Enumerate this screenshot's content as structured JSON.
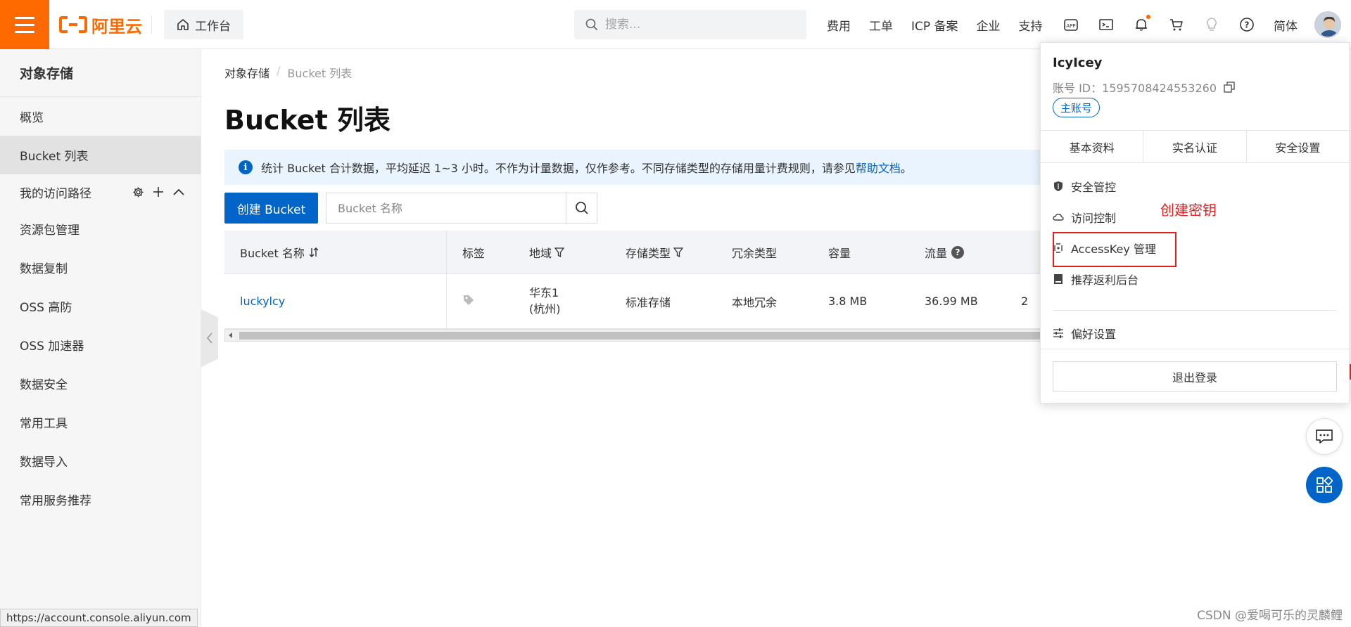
{
  "topbar": {
    "logo_text": "阿里云",
    "workbench_label": "工作台",
    "search_placeholder": "搜索...",
    "links": [
      "费用",
      "工单",
      "ICP 备案",
      "企业",
      "支持"
    ],
    "language": "简体",
    "brand_color": "#ff6a00"
  },
  "sidebar": {
    "title": "对象存储",
    "items": [
      {
        "label": "概览"
      },
      {
        "label": "Bucket 列表"
      },
      {
        "label": "我的访问路径"
      },
      {
        "label": "资源包管理"
      },
      {
        "label": "数据复制"
      },
      {
        "label": "OSS 高防"
      },
      {
        "label": "OSS 加速器"
      },
      {
        "label": "数据安全"
      },
      {
        "label": "常用工具"
      },
      {
        "label": "数据导入"
      },
      {
        "label": "常用服务推荐"
      }
    ]
  },
  "main": {
    "breadcrumb": [
      "对象存储",
      "Bucket 列表"
    ],
    "title": "Bucket 列表",
    "notice_text": "统计 Bucket 合计数据，平均延迟 1~3 小时。不作为计量数据，仅作参考。不同存储类型的存储用量计费规则，请参见",
    "notice_link": "帮助文档",
    "notice_end": "。",
    "create_button": "创建 Bucket",
    "filter_placeholder": "Bucket 名称",
    "table": {
      "headers": [
        "Bucket 名称",
        "标签",
        "地域",
        "存储类型",
        "冗余类型",
        "容量",
        "流量"
      ],
      "rows": [
        {
          "name": "luckylcy",
          "region_line1": "华东1",
          "region_line2": "(杭州)",
          "storage_type": "标准存储",
          "redundancy": "本地冗余",
          "capacity": "3.8 MB",
          "traffic": "36.99 MB",
          "extra": "2"
        }
      ]
    }
  },
  "account_panel": {
    "username": "IcyIcey",
    "account_id_label": "账号 ID：",
    "account_id": "1595708424553260",
    "badge": "主账号",
    "tabs": [
      "基本资料",
      "实名认证",
      "安全设置"
    ],
    "menu": [
      {
        "label": "安全管控",
        "icon": "shield-icon"
      },
      {
        "label": "访问控制",
        "icon": "cloud-icon"
      },
      {
        "label": "AccessKey 管理",
        "icon": "key-icon"
      },
      {
        "label": "推荐返利后台",
        "icon": "book-icon"
      },
      {
        "label": "偏好设置",
        "icon": "sliders-icon"
      }
    ],
    "annotation": "创建密钥",
    "logout": "退出登录"
  },
  "status_url": "https://account.console.aliyun.com",
  "watermark": "CSDN @爱喝可乐的灵麟鲤",
  "colors": {
    "primary": "#0064c8",
    "annotation_red": "#e02020"
  }
}
